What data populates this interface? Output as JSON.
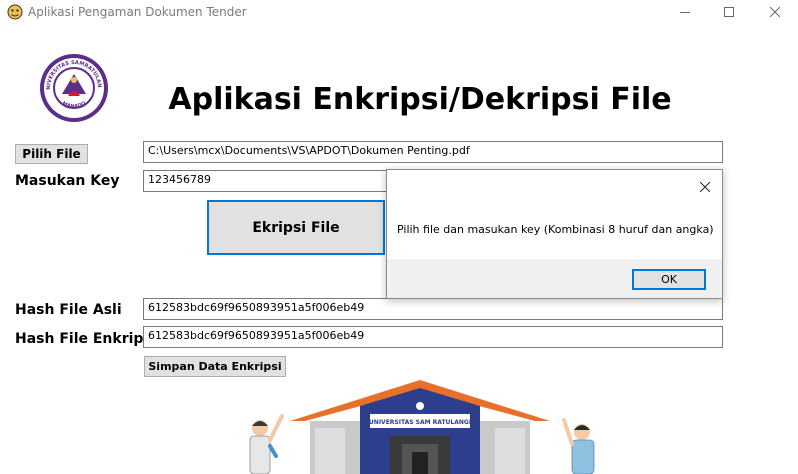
{
  "window": {
    "title": "Aplikasi Pengaman Dokumen Tender",
    "minimize_icon": "minimize-icon",
    "maximize_icon": "maximize-icon",
    "close_icon": "close-icon"
  },
  "header": {
    "heading": "Aplikasi Enkripsi/Dekripsi File",
    "logo": {
      "top_text": "UNIVERSITAS SAMRATULANGI",
      "bottom_text": "MANADO",
      "colors": {
        "ring": "#5b2d8c",
        "inner": "#ffffff",
        "accent": "#d7192f"
      }
    }
  },
  "form": {
    "pick_file_label": "Pilih File",
    "file_path": "C:\\Users\\mcx\\Documents\\VS\\APDOT\\Dokumen Penting.pdf",
    "key_label": "Masukan Key",
    "key_value": "123456789",
    "encrypt_label": "Ekripsi File",
    "hash_original_label": "Hash File Asli",
    "hash_original_value": "612583bdc69f9650893951a5f006eb49",
    "hash_encrypted_label": "Hash File Enkripsi",
    "hash_encrypted_value": "612583bdc69f9650893951a5f006eb49",
    "save_label": "Simpan Data Enkripsi"
  },
  "dialog": {
    "message": "Pilih file dan masukan key (Kombinasi 8 huruf dan angka)",
    "ok_label": "OK"
  },
  "illustration": {
    "building_sign": "UNIVERSITAS SAM RATULANGI",
    "colors": {
      "roof": "#e8702a",
      "facade": "#2c3e8c",
      "wall": "#c9c9c9",
      "door": "#3a3a3a"
    }
  },
  "colors": {
    "accent": "#0078d7",
    "button_face": "#e1e1e1",
    "footer_gray": "#f0f0f0"
  }
}
